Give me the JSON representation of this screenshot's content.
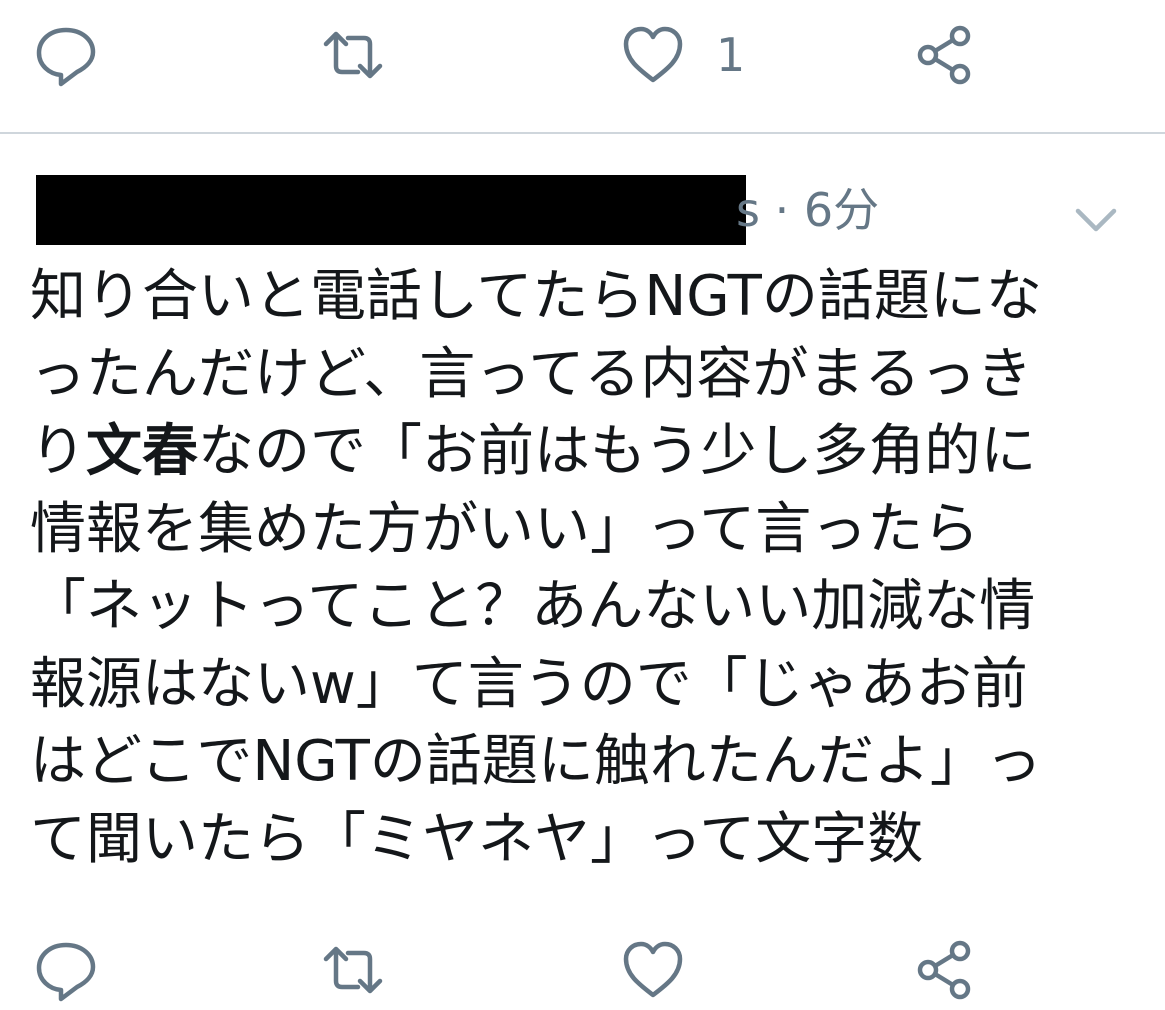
{
  "top_actions": {
    "reply_icon": "reply-icon",
    "retweet_icon": "retweet-icon",
    "like_icon": "heart-icon",
    "like_count": "1",
    "share_icon": "share-icon"
  },
  "tweet": {
    "meta": "s · 6分",
    "caret_icon": "chevron-down-icon",
    "lines": [
      "知り合いと電話してたらNGTの話題にな",
      "ったんだけど、言ってる内容がまるっき",
      "なので「お前はもう少し多角的に",
      "情報を集めた方がいい」って言ったら",
      "「ネットってこと？あんないい加減な情",
      "報源はないw」て言うので「じゃあお前",
      "はどこでNGTの話題に触れたんだよ」っ",
      "て聞いたら「ミヤネヤ」って文字数"
    ],
    "line3_prefix": "り",
    "line3_bold": "文春"
  },
  "bottom_actions": {
    "reply_icon": "reply-icon",
    "retweet_icon": "retweet-icon",
    "like_icon": "heart-icon",
    "share_icon": "share-icon"
  },
  "colors": {
    "icon": "#657786",
    "text": "#14171a",
    "divider": "#cfd6dc",
    "redaction": "#000000"
  }
}
